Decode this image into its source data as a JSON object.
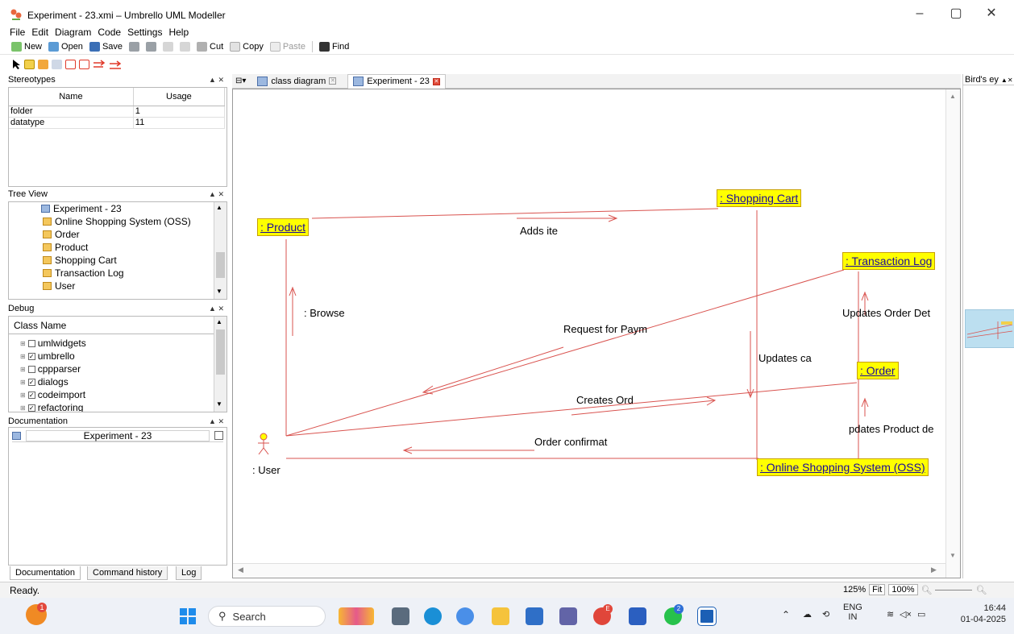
{
  "window": {
    "title": "Experiment - 23.xmi – Umbrello UML Modeller",
    "minimize": "–",
    "maximize": "▢",
    "close": "✕"
  },
  "menu": [
    "File",
    "Edit",
    "Diagram",
    "Code",
    "Settings",
    "Help"
  ],
  "toolbar": {
    "new": "New",
    "open": "Open",
    "save": "Save",
    "cut": "Cut",
    "copy": "Copy",
    "paste": "Paste",
    "find": "Find"
  },
  "stereotypes": {
    "title": "Stereotypes",
    "columns": [
      "Name",
      "Usage"
    ],
    "rows": [
      {
        "name": "folder",
        "usage": "1"
      },
      {
        "name": "datatype",
        "usage": "11"
      }
    ]
  },
  "tree_view": {
    "title": "Tree View",
    "items": [
      "Experiment - 23",
      "Online Shopping System (OSS)",
      "Order",
      "Product",
      "Shopping Cart",
      "Transaction Log",
      "User"
    ]
  },
  "debug": {
    "title": "Debug",
    "column": "Class Name",
    "items": [
      {
        "name": "umlwidgets",
        "checked": false
      },
      {
        "name": "umbrello",
        "checked": true
      },
      {
        "name": "cppparser",
        "checked": false
      },
      {
        "name": "dialogs",
        "checked": true
      },
      {
        "name": "codeimport",
        "checked": true
      },
      {
        "name": "refactoring",
        "checked": true
      }
    ]
  },
  "documentation": {
    "title": "Documentation",
    "field": "Experiment - 23"
  },
  "bottom_tabs": [
    "Documentation",
    "Command history",
    "Log"
  ],
  "diagram_tabs": [
    {
      "label": "class diagram",
      "active": false
    },
    {
      "label": "Experiment - 23",
      "active": true
    }
  ],
  "diagram": {
    "objects": {
      "product": ": Product",
      "shopping_cart": ": Shopping Cart",
      "transaction_log": ": Transaction Log",
      "order": ": Order",
      "oss": ": Online Shopping System (OSS)",
      "user": ": User"
    },
    "messages": {
      "adds_item": "Adds ite",
      "browse": ": Browse",
      "request_payment": "Request for Paym",
      "updates_cart": "Updates ca",
      "updates_order": "Updates Order Det",
      "creates_order": "Creates Ord",
      "updates_product": "pdates Product de",
      "order_confirm": "Order confirmat"
    }
  },
  "birds_eye": {
    "title": "Bird's ey"
  },
  "status": {
    "message": "Ready.",
    "zoom_level": "125%",
    "fit": "Fit",
    "reset": "100%"
  },
  "taskbar": {
    "search_placeholder": "Search",
    "notification_count": "1",
    "chrome_badge": "E",
    "whatsapp_badge": "2",
    "lang_primary": "ENG",
    "lang_region": "IN",
    "time": "16:44",
    "date": "01-04-2025"
  },
  "colors": {
    "object_fill": "#ffff00",
    "message_line": "#d9534f",
    "object_text": "#1a0a9a"
  }
}
